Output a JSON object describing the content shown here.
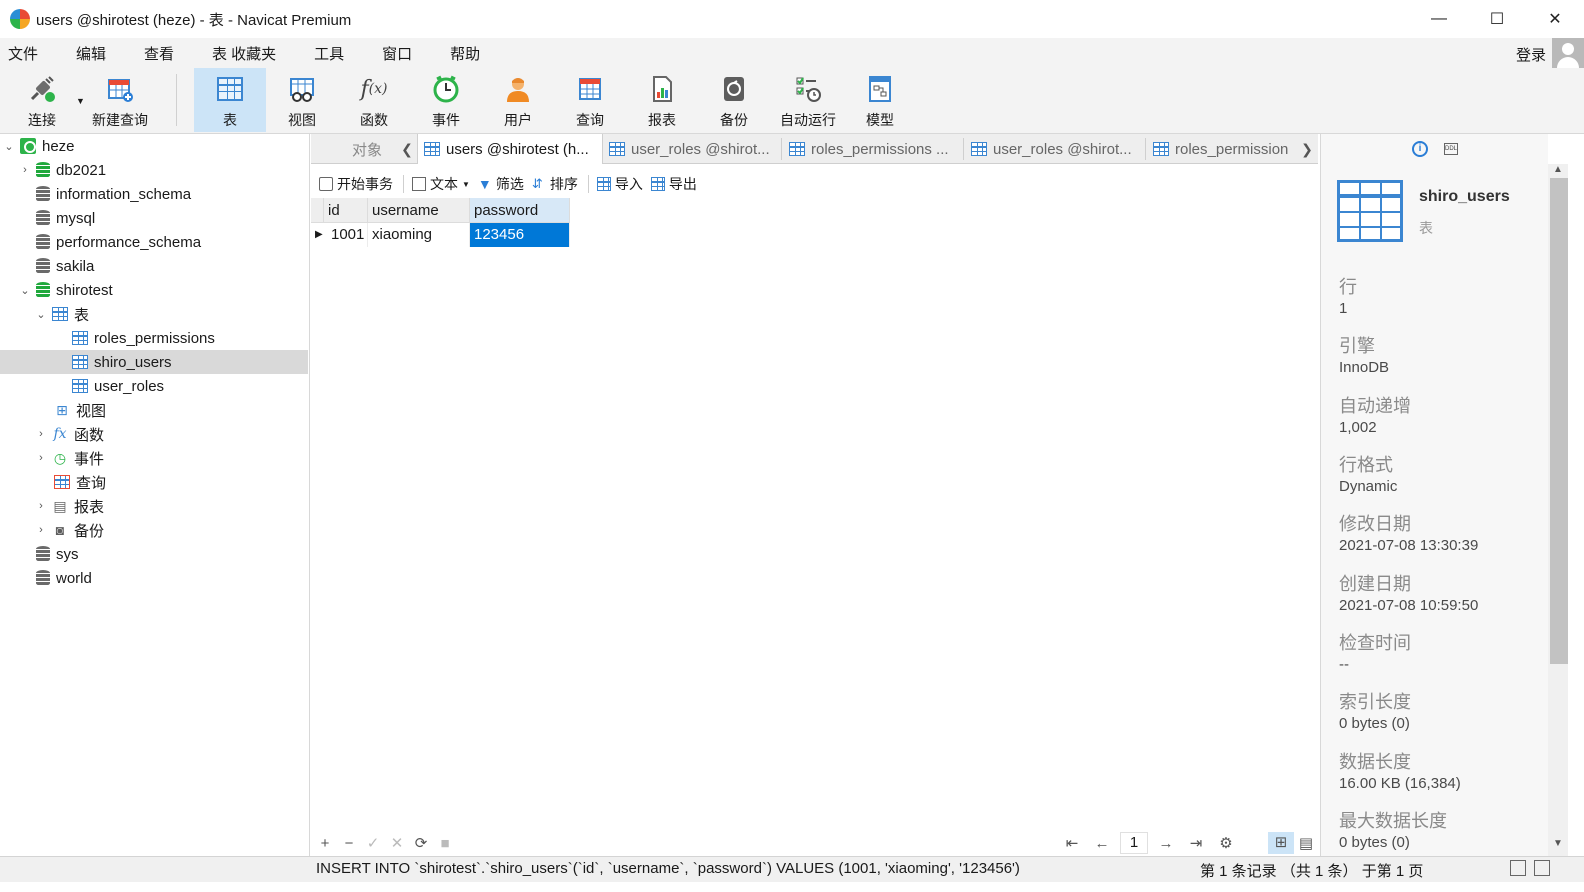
{
  "window": {
    "title": "users @shirotest (heze) - 表 - Navicat Premium",
    "minimize": "—",
    "maximize": "☐",
    "close": "✕"
  },
  "menu": {
    "items": [
      "文件",
      "编辑",
      "查看",
      "表",
      "收藏夹",
      "工具",
      "窗口",
      "帮助"
    ],
    "login": "登录"
  },
  "toolbar": {
    "buttons": [
      {
        "label": "连接",
        "icon": "plug-icon"
      },
      {
        "label": "新建查询",
        "icon": "new-query-icon"
      },
      {
        "label": "表",
        "icon": "table-icon"
      },
      {
        "label": "视图",
        "icon": "view-icon"
      },
      {
        "label": "函数",
        "icon": "function-icon"
      },
      {
        "label": "事件",
        "icon": "clock-icon"
      },
      {
        "label": "用户",
        "icon": "user-icon"
      },
      {
        "label": "查询",
        "icon": "query-icon"
      },
      {
        "label": "报表",
        "icon": "report-icon"
      },
      {
        "label": "备份",
        "icon": "backup-icon"
      },
      {
        "label": "自动运行",
        "icon": "automation-icon"
      },
      {
        "label": "模型",
        "icon": "model-icon"
      }
    ],
    "active": "表"
  },
  "tree": {
    "connection": "heze",
    "nodes": [
      {
        "label": "db2021"
      },
      {
        "label": "information_schema"
      },
      {
        "label": "mysql"
      },
      {
        "label": "performance_schema"
      },
      {
        "label": "sakila"
      },
      {
        "label": "shirotest"
      },
      {
        "label": "表"
      },
      {
        "label": "roles_permissions"
      },
      {
        "label": "shiro_users"
      },
      {
        "label": "user_roles"
      },
      {
        "label": "视图"
      },
      {
        "label": "函数"
      },
      {
        "label": "事件"
      },
      {
        "label": "查询"
      },
      {
        "label": "报表"
      },
      {
        "label": "备份"
      },
      {
        "label": "sys"
      },
      {
        "label": "world"
      }
    ],
    "selected": "shiro_users"
  },
  "tabs": {
    "objects_label": "对象",
    "items": [
      {
        "label": "users @shirotest (h..."
      },
      {
        "label": "user_roles @shirot..."
      },
      {
        "label": "roles_permissions ..."
      },
      {
        "label": "user_roles @shirot..."
      },
      {
        "label": "roles_permission"
      }
    ]
  },
  "object_toolbar": {
    "begin_transaction": "开始事务",
    "text": "文本",
    "filter": "筛选",
    "sort": "排序",
    "import": "导入",
    "export": "导出"
  },
  "grid": {
    "columns": [
      "id",
      "username",
      "password"
    ],
    "rows": [
      {
        "id": "1001",
        "username": "xiaoming",
        "password": "123456"
      }
    ],
    "selected_cell": {
      "row": 0,
      "column": "password"
    }
  },
  "grid_nav": {
    "add": "+",
    "remove": "−",
    "apply": "✓",
    "discard": "✕",
    "refresh": "⟳",
    "stop": "■",
    "first": "⇤",
    "prev": "←",
    "page": "1",
    "next": "→",
    "last": "⇥",
    "settings": "⚙"
  },
  "info_panel": {
    "name": "shiro_users",
    "kind": "表",
    "properties": [
      {
        "label": "行",
        "value": "1"
      },
      {
        "label": "引擎",
        "value": "InnoDB"
      },
      {
        "label": "自动递增",
        "value": "1,002"
      },
      {
        "label": "行格式",
        "value": "Dynamic"
      },
      {
        "label": "修改日期",
        "value": "2021-07-08 13:30:39"
      },
      {
        "label": "创建日期",
        "value": "2021-07-08 10:59:50"
      },
      {
        "label": "检查时间",
        "value": "--"
      },
      {
        "label": "索引长度",
        "value": "0 bytes (0)"
      },
      {
        "label": "数据长度",
        "value": "16.00 KB (16,384)"
      },
      {
        "label": "最大数据长度",
        "value": "0 bytes (0)"
      }
    ]
  },
  "status": {
    "sql": "INSERT INTO `shirotest`.`shiro_users`(`id`, `username`, `password`) VALUES (1001, 'xiaoming', '123456')",
    "records": "第 1 条记录 （共 1 条） 于第 1 页"
  }
}
